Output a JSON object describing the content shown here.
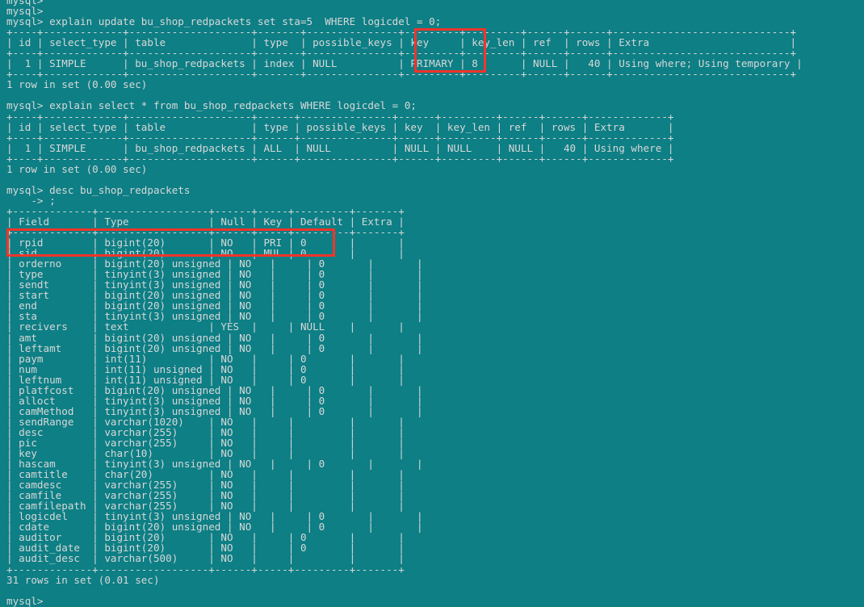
{
  "terminal": {
    "prompt": "mysql>",
    "continuation_prompt": "    -> ",
    "colors": {
      "background": "#0d7f85",
      "foreground": "#d8d8d8",
      "highlight_box": "#f5342a"
    },
    "clipped_top_line": "mysql>"
  },
  "lines": [
    {
      "name": "clipped-prompt",
      "text": "mysql>"
    },
    {
      "name": "prompt-blank",
      "text": "mysql>"
    },
    {
      "name": "command-explain-update",
      "text": "mysql> explain update bu_shop_redpackets set sta=5  WHERE logicdel = 0;"
    },
    {
      "name": "t1-rule-top",
      "text": "+----+-------------+--------------------+-------+---------------+---------+---------+------+------+-----------------------------+"
    },
    {
      "name": "t1-header",
      "text": "| id | select_type | table              | type  | possible_keys | key     | key_len | ref  | rows | Extra                       |"
    },
    {
      "name": "t1-rule-mid",
      "text": "+----+-------------+--------------------+-------+---------------+---------+---------+------+------+-----------------------------+"
    },
    {
      "name": "t1-row-1",
      "text": "|  1 | SIMPLE      | bu_shop_redpackets | index | NULL          | PRIMARY | 8       | NULL |   40 | Using where; Using temporary |"
    },
    {
      "name": "t1-rule-bot",
      "text": "+----+-------------+--------------------+-------+---------------+---------+---------+------+------+-----------------------------+"
    },
    {
      "name": "t1-result",
      "text": "1 row in set (0.00 sec)"
    },
    {
      "name": "blank-1",
      "text": ""
    },
    {
      "name": "command-explain-select",
      "text": "mysql> explain select * from bu_shop_redpackets WHERE logicdel = 0;"
    },
    {
      "name": "t2-rule-top",
      "text": "+----+-------------+--------------------+------+---------------+------+---------+------+------+-------------+"
    },
    {
      "name": "t2-header",
      "text": "| id | select_type | table              | type | possible_keys | key  | key_len | ref  | rows | Extra       |"
    },
    {
      "name": "t2-rule-mid",
      "text": "+----+-------------+--------------------+------+---------------+------+---------+------+------+-------------+"
    },
    {
      "name": "t2-row-1",
      "text": "|  1 | SIMPLE      | bu_shop_redpackets | ALL  | NULL          | NULL | NULL    | NULL |   40 | Using where |"
    },
    {
      "name": "t2-rule-bot",
      "text": "+----+-------------+--------------------+------+---------------+------+---------+------+------+-------------+"
    },
    {
      "name": "t2-result",
      "text": "1 row in set (0.00 sec)"
    },
    {
      "name": "blank-2",
      "text": ""
    },
    {
      "name": "command-desc",
      "text": "mysql> desc bu_shop_redpackets"
    },
    {
      "name": "continuation-semicolon",
      "text": "    -> ;"
    },
    {
      "name": "t3-rule-top",
      "text": "+-------------+------------------+------+-----+---------+-------+"
    },
    {
      "name": "t3-header",
      "text": "| Field       | Type             | Null | Key | Default | Extra |"
    },
    {
      "name": "t3-rule-mid",
      "text": "+-------------+------------------+------+-----+---------+-------+"
    },
    {
      "name": "t3-row-rpid",
      "text": "| rpid        | bigint(20)       | NO   | PRI | 0       |       |"
    },
    {
      "name": "t3-row-sid",
      "text": "| sid         | bigint(20)       | NO   | MUL | 0       |       |"
    },
    {
      "name": "t3-row-orderno",
      "text": "| orderno     | bigint(20) unsigned | NO   |     | 0       |       |"
    },
    {
      "name": "t3-row-type",
      "text": "| type        | tinyint(3) unsigned | NO   |     | 0       |       |"
    },
    {
      "name": "t3-row-sendt",
      "text": "| sendt       | tinyint(3) unsigned | NO   |     | 0       |       |"
    },
    {
      "name": "t3-row-start",
      "text": "| start       | bigint(20) unsigned | NO   |     | 0       |       |"
    },
    {
      "name": "t3-row-end",
      "text": "| end         | bigint(20) unsigned | NO   |     | 0       |       |"
    },
    {
      "name": "t3-row-sta",
      "text": "| sta         | tinyint(3) unsigned | NO   |     | 0       |       |"
    },
    {
      "name": "t3-row-recivers",
      "text": "| recivers    | text             | YES  |     | NULL    |       |"
    },
    {
      "name": "t3-row-amt",
      "text": "| amt         | bigint(20) unsigned | NO   |     | 0       |       |"
    },
    {
      "name": "t3-row-leftamt",
      "text": "| leftamt     | bigint(20) unsigned | NO   |     | 0       |       |"
    },
    {
      "name": "t3-row-paym",
      "text": "| paym        | int(11)          | NO   |     | 0       |       |"
    },
    {
      "name": "t3-row-num",
      "text": "| num         | int(11) unsigned | NO   |     | 0       |       |"
    },
    {
      "name": "t3-row-leftnum",
      "text": "| leftnum     | int(11) unsigned | NO   |     | 0       |       |"
    },
    {
      "name": "t3-row-platfcost",
      "text": "| platfcost   | bigint(20) unsigned | NO   |     | 0       |       |"
    },
    {
      "name": "t3-row-alloct",
      "text": "| alloct      | tinyint(3) unsigned | NO   |     | 0       |       |"
    },
    {
      "name": "t3-row-camMethod",
      "text": "| camMethod   | tinyint(3) unsigned | NO   |     | 0       |       |"
    },
    {
      "name": "t3-row-sendRange",
      "text": "| sendRange   | varchar(1020)    | NO   |     |         |       |"
    },
    {
      "name": "t3-row-desc",
      "text": "| desc        | varchar(255)     | NO   |     |         |       |"
    },
    {
      "name": "t3-row-pic",
      "text": "| pic         | varchar(255)     | NO   |     |         |       |"
    },
    {
      "name": "t3-row-key",
      "text": "| key         | char(10)         | NO   |     |         |       |"
    },
    {
      "name": "t3-row-hascam",
      "text": "| hascam      | tinyint(3) unsigned | NO   |     | 0       |       |"
    },
    {
      "name": "t3-row-camtitle",
      "text": "| camtitle    | char(20)         | NO   |     |         |       |"
    },
    {
      "name": "t3-row-camdesc",
      "text": "| camdesc     | varchar(255)     | NO   |     |         |       |"
    },
    {
      "name": "t3-row-camfile",
      "text": "| camfile     | varchar(255)     | NO   |     |         |       |"
    },
    {
      "name": "t3-row-camfilepath",
      "text": "| camfilepath | varchar(255)     | NO   |     |         |       |"
    },
    {
      "name": "t3-row-logicdel",
      "text": "| logicdel    | tinyint(3) unsigned | NO   |     | 0       |       |"
    },
    {
      "name": "t3-row-cdate",
      "text": "| cdate       | bigint(20) unsigned | NO   |     | 0       |       |"
    },
    {
      "name": "t3-row-auditor",
      "text": "| auditor     | bigint(20)       | NO   |     | 0       |       |"
    },
    {
      "name": "t3-row-audit_date",
      "text": "| audit_date  | bigint(20)       | NO   |     | 0       |       |"
    },
    {
      "name": "t3-row-audit_desc",
      "text": "| audit_desc  | varchar(500)     | NO   |     |         |       |"
    },
    {
      "name": "t3-rule-bot",
      "text": "+-------------+------------------+------+-----+---------+-------+"
    },
    {
      "name": "t3-result",
      "text": "31 rows in set (0.01 sec)"
    },
    {
      "name": "blank-3",
      "text": ""
    },
    {
      "name": "final-prompt",
      "text": "mysql>"
    }
  ],
  "highlights": [
    {
      "name": "key-primary-highlight",
      "label": "key / PRIMARY column highlight",
      "target_column": "key",
      "target_value": "PRIMARY"
    },
    {
      "name": "primary-key-rows-highlight",
      "label": "rpid PRI / sid MUL rows highlight",
      "target_rows": [
        "rpid",
        "sid"
      ]
    }
  ],
  "explain_results": [
    {
      "query": "explain update bu_shop_redpackets set sta=5  WHERE logicdel = 0;",
      "columns": [
        "id",
        "select_type",
        "table",
        "type",
        "possible_keys",
        "key",
        "key_len",
        "ref",
        "rows",
        "Extra"
      ],
      "rows": [
        [
          "1",
          "SIMPLE",
          "bu_shop_redpackets",
          "index",
          "NULL",
          "PRIMARY",
          "8",
          "NULL",
          "40",
          "Using where; Using temporary"
        ]
      ],
      "result_text": "1 row in set (0.00 sec)"
    },
    {
      "query": "explain select * from bu_shop_redpackets WHERE logicdel = 0;",
      "columns": [
        "id",
        "select_type",
        "table",
        "type",
        "possible_keys",
        "key",
        "key_len",
        "ref",
        "rows",
        "Extra"
      ],
      "rows": [
        [
          "1",
          "SIMPLE",
          "bu_shop_redpackets",
          "ALL",
          "NULL",
          "NULL",
          "NULL",
          "NULL",
          "40",
          "Using where"
        ]
      ],
      "result_text": "1 row in set (0.00 sec)"
    }
  ],
  "describe_result": {
    "query": "desc bu_shop_redpackets",
    "columns": [
      "Field",
      "Type",
      "Null",
      "Key",
      "Default",
      "Extra"
    ],
    "rows": [
      [
        "rpid",
        "bigint(20)",
        "NO",
        "PRI",
        "0",
        ""
      ],
      [
        "sid",
        "bigint(20)",
        "NO",
        "MUL",
        "0",
        ""
      ],
      [
        "orderno",
        "bigint(20) unsigned",
        "NO",
        "",
        "0",
        ""
      ],
      [
        "type",
        "tinyint(3) unsigned",
        "NO",
        "",
        "0",
        ""
      ],
      [
        "sendt",
        "tinyint(3) unsigned",
        "NO",
        "",
        "0",
        ""
      ],
      [
        "start",
        "bigint(20) unsigned",
        "NO",
        "",
        "0",
        ""
      ],
      [
        "end",
        "bigint(20) unsigned",
        "NO",
        "",
        "0",
        ""
      ],
      [
        "sta",
        "tinyint(3) unsigned",
        "NO",
        "",
        "0",
        ""
      ],
      [
        "recivers",
        "text",
        "YES",
        "",
        "NULL",
        ""
      ],
      [
        "amt",
        "bigint(20) unsigned",
        "NO",
        "",
        "0",
        ""
      ],
      [
        "leftamt",
        "bigint(20) unsigned",
        "NO",
        "",
        "0",
        ""
      ],
      [
        "paym",
        "int(11)",
        "NO",
        "",
        "0",
        ""
      ],
      [
        "num",
        "int(11) unsigned",
        "NO",
        "",
        "0",
        ""
      ],
      [
        "leftnum",
        "int(11) unsigned",
        "NO",
        "",
        "0",
        ""
      ],
      [
        "platfcost",
        "bigint(20) unsigned",
        "NO",
        "",
        "0",
        ""
      ],
      [
        "alloct",
        "tinyint(3) unsigned",
        "NO",
        "",
        "0",
        ""
      ],
      [
        "camMethod",
        "tinyint(3) unsigned",
        "NO",
        "",
        "0",
        ""
      ],
      [
        "sendRange",
        "varchar(1020)",
        "NO",
        "",
        "",
        ""
      ],
      [
        "desc",
        "varchar(255)",
        "NO",
        "",
        "",
        ""
      ],
      [
        "pic",
        "varchar(255)",
        "NO",
        "",
        "",
        ""
      ],
      [
        "key",
        "char(10)",
        "NO",
        "",
        "",
        ""
      ],
      [
        "hascam",
        "tinyint(3) unsigned",
        "NO",
        "",
        "0",
        ""
      ],
      [
        "camtitle",
        "char(20)",
        "NO",
        "",
        "",
        ""
      ],
      [
        "camdesc",
        "varchar(255)",
        "NO",
        "",
        "",
        ""
      ],
      [
        "camfile",
        "varchar(255)",
        "NO",
        "",
        "",
        ""
      ],
      [
        "camfilepath",
        "varchar(255)",
        "NO",
        "",
        "",
        ""
      ],
      [
        "logicdel",
        "tinyint(3) unsigned",
        "NO",
        "",
        "0",
        ""
      ],
      [
        "cdate",
        "bigint(20) unsigned",
        "NO",
        "",
        "0",
        ""
      ],
      [
        "auditor",
        "bigint(20)",
        "NO",
        "",
        "0",
        ""
      ],
      [
        "audit_date",
        "bigint(20)",
        "NO",
        "",
        "0",
        ""
      ],
      [
        "audit_desc",
        "varchar(500)",
        "NO",
        "",
        "",
        ""
      ]
    ],
    "result_text": "31 rows in set (0.01 sec)"
  }
}
